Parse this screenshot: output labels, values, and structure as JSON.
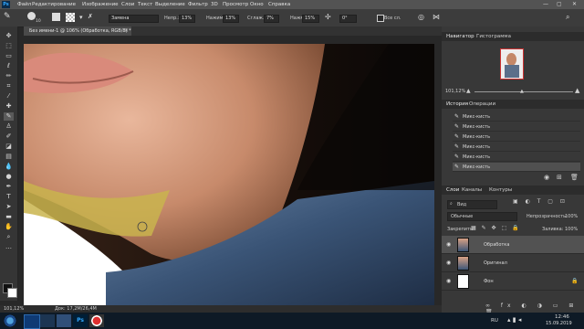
{
  "menu": {
    "app_logo": "Ps",
    "items": [
      "Файл",
      "Редактирование",
      "Изображение",
      "Слои",
      "Текст",
      "Выделение",
      "Фильтр",
      "3D",
      "Просмотр",
      "Окно",
      "Справка"
    ],
    "window_controls": [
      "—",
      "▢",
      "✕"
    ]
  },
  "options": {
    "brush_size": "10",
    "mode_value": "Замена",
    "opacity_label": "Непр.:",
    "opacity_value": "13%",
    "flow_label": "Нажим:",
    "flow_value": "13%",
    "smoothing_label": "Сглаж.:",
    "smoothing_value": "7%",
    "strength_label": "Нажм.:",
    "strength_value": "15%",
    "angle_value": "0°",
    "all_layers_label": "Все сл."
  },
  "document": {
    "tab_label": "Без имени-1 @ 106% (Обработка, RGB/8) *",
    "zoom": "101,12%",
    "doc_info": "Док: 17,2M/26,4M"
  },
  "navigator": {
    "tabs": [
      "Навигатор",
      "Гистограмма"
    ],
    "zoom": "101,12%"
  },
  "history": {
    "tabs": [
      "История",
      "Операции"
    ],
    "items": [
      "Микс-кисть",
      "Микс-кисть",
      "Микс-кисть",
      "Микс-кисть",
      "Микс-кисть",
      "Микс-кисть"
    ]
  },
  "layers": {
    "tabs": [
      "Слои",
      "Каналы",
      "Контуры"
    ],
    "filter_label": "Вид",
    "blend_mode": "Обычные",
    "opacity_label": "Непрозрачность:",
    "opacity_value": "100%",
    "lock_label": "Закрепить:",
    "fill_label": "Заливка:",
    "fill_value": "100%",
    "items": [
      {
        "name": "Обработка",
        "selected": true
      },
      {
        "name": "Оригинал",
        "selected": false
      },
      {
        "name": "Фон",
        "selected": false
      }
    ]
  },
  "taskbar": {
    "lang": "RU",
    "time": "12:46",
    "date": "15.09.2019"
  },
  "colors": {
    "accent": "#31a8ff",
    "panel": "#383838",
    "selected_layer": "#525252"
  }
}
